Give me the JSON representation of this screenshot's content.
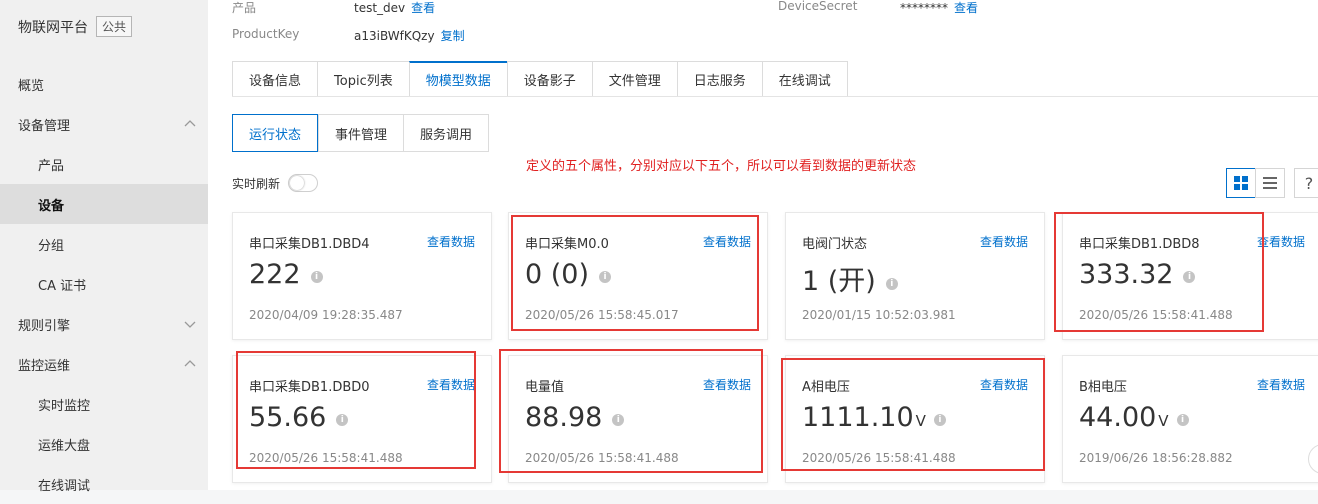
{
  "sidebar": {
    "brand_title": "物联网平台",
    "brand_tag": "公共",
    "items": [
      {
        "label": "概览",
        "type": "top"
      },
      {
        "label": "设备管理",
        "type": "top",
        "chevron": "up"
      },
      {
        "label": "产品",
        "type": "sub"
      },
      {
        "label": "设备",
        "type": "sub",
        "active": true
      },
      {
        "label": "分组",
        "type": "sub"
      },
      {
        "label": "CA 证书",
        "type": "sub"
      },
      {
        "label": "规则引擎",
        "type": "top",
        "chevron": "down"
      },
      {
        "label": "监控运维",
        "type": "top",
        "chevron": "up"
      },
      {
        "label": "实时监控",
        "type": "sub"
      },
      {
        "label": "运维大盘",
        "type": "sub"
      },
      {
        "label": "在线调试",
        "type": "sub"
      }
    ]
  },
  "device_meta": {
    "product_label": "产品",
    "product_value": "test_dev",
    "product_link": "查看",
    "productkey_label": "ProductKey",
    "productkey_value": "a13iBWfKQzy",
    "productkey_link": "复制",
    "secret_label": "DeviceSecret",
    "secret_value": "********",
    "secret_link": "查看"
  },
  "tabs": [
    "设备信息",
    "Topic列表",
    "物模型数据",
    "设备影子",
    "文件管理",
    "日志服务",
    "在线调试"
  ],
  "active_tab": 2,
  "subtabs": [
    "运行状态",
    "事件管理",
    "服务调用"
  ],
  "active_subtab": 0,
  "annotation": "定义的五个属性，分别对应以下五个，所以可以看到数据的更新状态",
  "refresh_label": "实时刷新",
  "help_label": "?",
  "accent_color": "#0070cc",
  "highlight_color": "#e53935",
  "cards": [
    {
      "title": "串口采集DB1.DBD4",
      "link": "查看数据",
      "value": "222",
      "unit": "",
      "time": "2020/04/09 19:28:35.487"
    },
    {
      "title": "串口采集M0.0",
      "link": "查看数据",
      "value": "0 (0)",
      "unit": "",
      "time": "2020/05/26 15:58:45.017"
    },
    {
      "title": "电阀门状态",
      "link": "查看数据",
      "value": "1 (开)",
      "unit": "",
      "time": "2020/01/15 10:52:03.981"
    },
    {
      "title": "串口采集DB1.DBD8",
      "link": "查看数据",
      "value": "333.32",
      "unit": "",
      "time": "2020/05/26 15:58:41.488"
    },
    {
      "title": "串口采集DB1.DBD0",
      "link": "查看数据",
      "value": "55.66",
      "unit": "",
      "time": "2020/05/26 15:58:41.488"
    },
    {
      "title": "电量值",
      "link": "查看数据",
      "value": "88.98",
      "unit": "",
      "time": "2020/05/26 15:58:41.488"
    },
    {
      "title": "A相电压",
      "link": "查看数据",
      "value": "1111.10",
      "unit": "V",
      "time": "2020/05/26 15:58:41.488"
    },
    {
      "title": "B相电压",
      "link": "查看数据",
      "value": "44.00",
      "unit": "V",
      "time": "2019/06/26 18:56:28.882"
    }
  ]
}
